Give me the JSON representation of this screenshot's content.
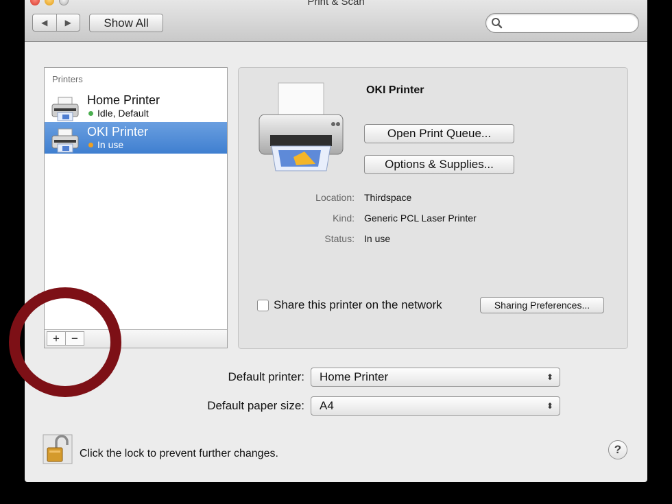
{
  "window": {
    "title": "Print & Scan"
  },
  "toolbar": {
    "back_icon": "◀",
    "forward_icon": "▶",
    "show_all_label": "Show All",
    "search_placeholder": ""
  },
  "printers": {
    "header": "Printers",
    "items": [
      {
        "name": "Home Printer",
        "status": "Idle, Default",
        "status_color": "#4caf50",
        "selected": false
      },
      {
        "name": "OKI Printer",
        "status": "In use",
        "status_color": "#f0a020",
        "selected": true
      }
    ],
    "add_label": "+",
    "remove_label": "−"
  },
  "detail": {
    "printer_name": "OKI Printer",
    "open_queue_label": "Open Print Queue...",
    "options_label": "Options & Supplies...",
    "location_label": "Location:",
    "location_value": "Thirdspace",
    "kind_label": "Kind:",
    "kind_value": "Generic PCL Laser Printer",
    "status_label": "Status:",
    "status_value": "In use",
    "share_label": "Share this printer on the network",
    "share_checked": false,
    "sharing_prefs_label": "Sharing Preferences..."
  },
  "defaults": {
    "printer_label": "Default printer:",
    "printer_value": "Home Printer",
    "paper_label": "Default paper size:",
    "paper_value": "A4",
    "popup_arrows": "⬍"
  },
  "footer": {
    "lock_text": "Click the lock to prevent further changes.",
    "help_label": "?"
  },
  "colors": {
    "selection": "#4a86d6",
    "highlight_circle": "#7d1016"
  }
}
